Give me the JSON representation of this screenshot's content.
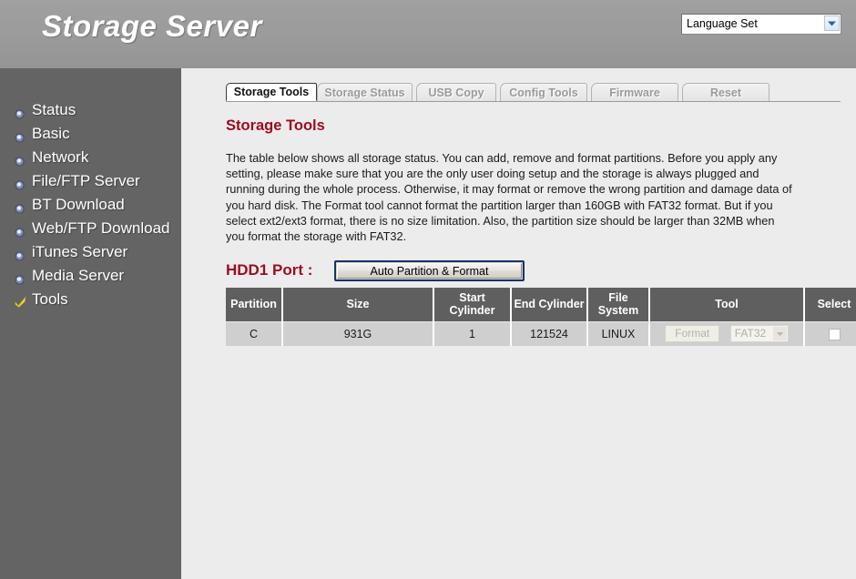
{
  "header": {
    "title": "Storage Server",
    "language": {
      "selected": "Language Set",
      "arrow_icon": "chevron-down-icon"
    }
  },
  "sidebar": {
    "items": [
      {
        "label": "Status",
        "icon": "bullet-icon",
        "active": false
      },
      {
        "label": "Basic",
        "icon": "bullet-icon",
        "active": false
      },
      {
        "label": "Network",
        "icon": "bullet-icon",
        "active": false
      },
      {
        "label": "File/FTP Server",
        "icon": "bullet-icon",
        "active": false
      },
      {
        "label": "BT Download",
        "icon": "bullet-icon",
        "active": false
      },
      {
        "label": "Web/FTP Download",
        "icon": "bullet-icon",
        "active": false
      },
      {
        "label": "iTunes Server",
        "icon": "bullet-icon",
        "active": false
      },
      {
        "label": "Media Server",
        "icon": "bullet-icon",
        "active": false
      },
      {
        "label": "Tools",
        "icon": "check-icon",
        "active": true
      }
    ]
  },
  "tabs": [
    {
      "label": "Storage Tools",
      "active": true
    },
    {
      "label": "Storage Status",
      "active": false
    },
    {
      "label": "USB Copy",
      "active": false
    },
    {
      "label": "Config Tools",
      "active": false
    },
    {
      "label": "Firmware",
      "active": false
    },
    {
      "label": "Reset",
      "active": false
    }
  ],
  "content": {
    "heading": "Storage Tools",
    "description": "The table below shows all storage status. You can add, remove and format partitions. Before you apply any setting, please make sure that you are the only user doing setup and the storage is always plugged and running during the whole process. Otherwise, it may format or remove the wrong partition and damage data of you hard disk. The Format tool cannot format the partition larger than 160GB with FAT32 format. But if you select ext2/ext3 format, there is no size limitation. Also, the partition size should be larger than 32MB when you format the storage with FAT32.",
    "hdd_label": "HDD1 Port :",
    "auto_format_button": "Auto Partition & Format"
  },
  "table": {
    "columns": [
      "Partition",
      "Size",
      "Start Cylinder",
      "End Cylinder",
      "File System",
      "Tool",
      "Select"
    ],
    "rows": [
      {
        "partition": "C",
        "size": "931G",
        "start_cylinder": "1",
        "end_cylinder": "121524",
        "file_system": "LINUX",
        "format_button": "Format",
        "format_button_disabled": true,
        "fs_select": "FAT32",
        "fs_select_disabled": true,
        "selected": false
      }
    ]
  },
  "colors": {
    "header_bg": "#9a9a9a",
    "sidebar_bg": "#646464",
    "content_bg": "#ececec",
    "accent_red": "#9e0b1e",
    "table_header_bg": "#5f5f5f",
    "table_row_bg": "#cfcfcf",
    "button_border": "#17316b",
    "check_yellow": "#f5e03c"
  }
}
